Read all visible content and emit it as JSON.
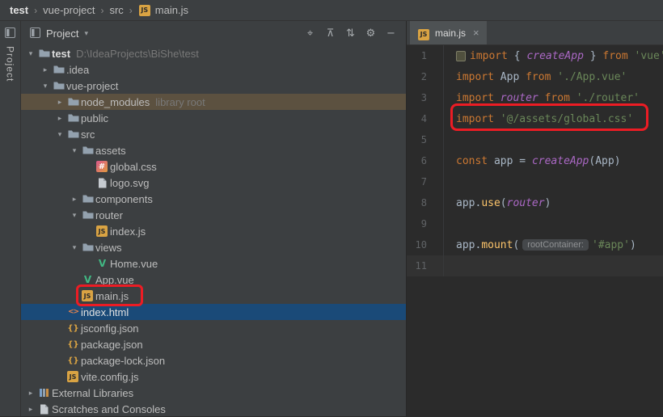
{
  "colors": {
    "editor_bg": "#2b2b2b",
    "panel_bg": "#3c3f41",
    "border": "#323232",
    "text": "#bbbbbb",
    "hint": "#787878",
    "selection": "#1a4a78",
    "library_row": "#5c5140",
    "current_line": "#323232",
    "line_number": "#606366",
    "keyword": "#cc7832",
    "string": "#6a8759",
    "identifier": "#a9b7c6",
    "imported": "#ab68c5",
    "method": "#ffc66b",
    "tab_active": "#4e5254",
    "annotation": "#ec1c24",
    "vue_green": "#41b883",
    "badge_yellow": "#d9a343"
  },
  "breadcrumb": {
    "separator": "›",
    "items": [
      {
        "label": "test",
        "bold": true
      },
      {
        "label": "vue-project"
      },
      {
        "label": "src"
      },
      {
        "label": "main.js",
        "icon": "js"
      }
    ]
  },
  "tool_strip": {
    "label": "Project"
  },
  "project_panel": {
    "title": "Project",
    "caret": "▾",
    "toolbar": [
      {
        "name": "locate-icon",
        "glyph": "⌖"
      },
      {
        "name": "collapse-all-icon",
        "glyph": "⊼"
      },
      {
        "name": "expand-collapse-icon",
        "glyph": "⇅"
      },
      {
        "name": "settings-icon",
        "glyph": "⚙"
      },
      {
        "name": "hide-icon",
        "glyph": "−"
      }
    ],
    "tree": [
      {
        "indent": 0,
        "chevron": "down",
        "icon": "folder",
        "label": "test",
        "hint": "D:\\IdeaProjects\\BiShe\\test",
        "bold": true
      },
      {
        "indent": 1,
        "chevron": "right",
        "icon": "folder",
        "label": ".idea"
      },
      {
        "indent": 1,
        "chevron": "down",
        "icon": "folder",
        "label": "vue-project"
      },
      {
        "indent": 2,
        "chevron": "right",
        "icon": "folder",
        "label": "node_modules",
        "hint": "library root",
        "state": "library"
      },
      {
        "indent": 2,
        "chevron": "right",
        "icon": "folder",
        "label": "public"
      },
      {
        "indent": 2,
        "chevron": "down",
        "icon": "folder",
        "label": "src"
      },
      {
        "indent": 3,
        "chevron": "down",
        "icon": "folder",
        "label": "assets"
      },
      {
        "indent": 4,
        "chevron": "",
        "icon": "css",
        "label": "global.css"
      },
      {
        "indent": 4,
        "chevron": "",
        "icon": "file",
        "label": "logo.svg"
      },
      {
        "indent": 3,
        "chevron": "right",
        "icon": "folder",
        "label": "components"
      },
      {
        "indent": 3,
        "chevron": "down",
        "icon": "folder",
        "label": "router"
      },
      {
        "indent": 4,
        "chevron": "",
        "icon": "js",
        "label": "index.js"
      },
      {
        "indent": 3,
        "chevron": "down",
        "icon": "folder",
        "label": "views"
      },
      {
        "indent": 4,
        "chevron": "",
        "icon": "vue",
        "label": "Home.vue"
      },
      {
        "indent": 3,
        "chevron": "",
        "icon": "vue",
        "label": "App.vue"
      },
      {
        "indent": 3,
        "chevron": "",
        "icon": "js",
        "label": "main.js",
        "annotated": true
      },
      {
        "indent": 2,
        "chevron": "",
        "icon": "html",
        "label": "index.html",
        "state": "selected"
      },
      {
        "indent": 2,
        "chevron": "",
        "icon": "json",
        "label": "jsconfig.json"
      },
      {
        "indent": 2,
        "chevron": "",
        "icon": "json",
        "label": "package.json"
      },
      {
        "indent": 2,
        "chevron": "",
        "icon": "json",
        "label": "package-lock.json"
      },
      {
        "indent": 2,
        "chevron": "",
        "icon": "js",
        "label": "vite.config.js"
      },
      {
        "indent": 0,
        "chevron": "right",
        "icon": "lib",
        "label": "External Libraries"
      },
      {
        "indent": 0,
        "chevron": "right",
        "icon": "scratch",
        "label": "Scratches and Consoles"
      }
    ]
  },
  "editor": {
    "tab": {
      "icon": "js",
      "label": "main.js",
      "close": "×"
    },
    "inlay_hint": "rootContainer:",
    "lines": [
      {
        "n": 1,
        "icon": true,
        "s": [
          [
            "kw",
            "import"
          ],
          [
            "pl",
            " { "
          ],
          [
            "imp",
            "createApp"
          ],
          [
            "pl",
            " } "
          ],
          [
            "kw",
            "from"
          ],
          [
            "pl",
            " "
          ],
          [
            "str",
            "'vue'"
          ]
        ]
      },
      {
        "n": 2,
        "s": [
          [
            "kw",
            "import"
          ],
          [
            "pl",
            " App "
          ],
          [
            "kw",
            "from"
          ],
          [
            "pl",
            " "
          ],
          [
            "str",
            "'./App.vue'"
          ]
        ]
      },
      {
        "n": 3,
        "s": [
          [
            "kw",
            "import"
          ],
          [
            "pl",
            " "
          ],
          [
            "imp",
            "router"
          ],
          [
            "pl",
            " "
          ],
          [
            "kw",
            "from"
          ],
          [
            "pl",
            " "
          ],
          [
            "str",
            "'./router'"
          ]
        ]
      },
      {
        "n": 4,
        "s": [
          [
            "kw",
            "import"
          ],
          [
            "pl",
            " "
          ],
          [
            "str",
            "'@/assets/global.css'"
          ]
        ],
        "annotated": true
      },
      {
        "n": 5,
        "s": []
      },
      {
        "n": 6,
        "s": [
          [
            "kw",
            "const"
          ],
          [
            "pl",
            " app = "
          ],
          [
            "imp",
            "createApp"
          ],
          [
            "pl",
            "("
          ],
          [
            "pl",
            "App"
          ],
          [
            "pl",
            ")"
          ]
        ]
      },
      {
        "n": 7,
        "s": []
      },
      {
        "n": 8,
        "s": [
          [
            "pl",
            "app"
          ],
          [
            "pl",
            "."
          ],
          [
            "fn",
            "use"
          ],
          [
            "pl",
            "("
          ],
          [
            "imp",
            "router"
          ],
          [
            "pl",
            ")"
          ]
        ]
      },
      {
        "n": 9,
        "s": []
      },
      {
        "n": 10,
        "s": [
          [
            "pl",
            "app"
          ],
          [
            "pl",
            "."
          ],
          [
            "fn",
            "mount"
          ],
          [
            "pl",
            "("
          ],
          [
            "inlay",
            "rootContainer:"
          ],
          [
            "str",
            "'#app'"
          ],
          [
            "pl",
            ")"
          ]
        ]
      },
      {
        "n": 11,
        "s": [],
        "current": true
      }
    ]
  }
}
